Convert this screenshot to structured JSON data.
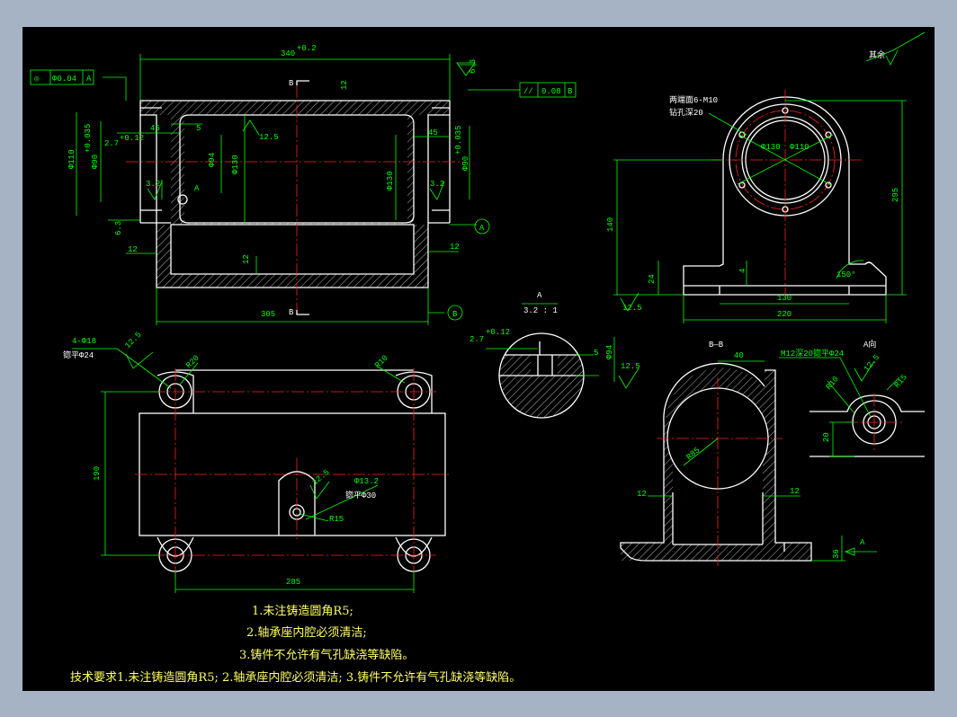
{
  "sheet": {
    "background": "#a6b3c5",
    "paper": "#000000",
    "line": "#ffffff",
    "dimension": "#00ff00",
    "center": "#ff2020",
    "note": "#ffff66"
  },
  "front_view": {
    "dims": {
      "top_len": "340",
      "top_tol": "+0.2",
      "top_tol2": "0",
      "flat_sym": "6.3",
      "tol_frame_a": "◎",
      "tol_frame_a_val": "Φ0.04",
      "tol_frame_a_ref": "A",
      "par_frame": "//",
      "par_val": "0.08",
      "par_ref": "B",
      "d45l": "45",
      "d45r": "45",
      "d5": "5",
      "d12top": "12",
      "d27": "2.7",
      "d27tol": "+0.12",
      "phi110": "Φ110",
      "phi90l": "Φ90",
      "phi90tol": "+0.035",
      "phi94": "Φ94",
      "phi130a": "Φ130",
      "phi130b": "Φ130",
      "phi90r": "Φ90",
      "phi90rtol": "+0.035",
      "r125": "12.5",
      "rough32a": "3.2",
      "rough32b": "3.2",
      "label_a": "A",
      "d63": "6.3",
      "d12a": "12",
      "d12b": "12",
      "d12c": "12",
      "d305": "305",
      "sec_b_top": "B",
      "sec_b_bot": "B",
      "circ_a": "A",
      "circ_b": "B"
    }
  },
  "side_view": {
    "dims": {
      "holes_note1": "两端面6-M10",
      "holes_note2": "钻孔深20",
      "phi130": "Φ130",
      "phi110": "Φ110",
      "d295": "295",
      "d140": "140",
      "d24": "24",
      "d4": "4",
      "d130": "130",
      "d220": "220",
      "ang150": "150°",
      "r125": "12.5",
      "other": "其余"
    }
  },
  "detail_a": {
    "title": "A",
    "scale": "3.2 : 1",
    "d27": "2.7",
    "d27tol": "+0.12",
    "phi94": "Φ94",
    "d5": "5",
    "r125": "12.5"
  },
  "top_view": {
    "dims": {
      "holes1": "4-Φ18",
      "holes2": "锪平Φ24",
      "r125": "12.5",
      "r20": "R20",
      "r10": "R10",
      "d190": "190",
      "d285": "285",
      "r125b": "12.5",
      "phi132": "Φ13.2",
      "spot30": "锪平Φ30",
      "r15": "R15"
    }
  },
  "section_bb": {
    "title": "B—B",
    "d40": "40",
    "r85": "R85",
    "d12l": "12",
    "d12r": "12",
    "d36": "36",
    "arrow_a": "A"
  },
  "view_a": {
    "title": "A向",
    "note": "M12深20锪平Φ24",
    "r125": "12.5",
    "r10": "R10",
    "r15": "R15",
    "d20": "20"
  },
  "notes": {
    "n1": "1.未注铸造圆角R5;",
    "n2": "2.轴承座内腔必须清洁;",
    "n3": "3.铸件不允许有气孔缺浇等缺陷。",
    "tech": "技术要求1.未注铸造圆角R5; 2.轴承座内腔必须清洁; 3.铸件不允许有气孔缺浇等缺陷。"
  }
}
